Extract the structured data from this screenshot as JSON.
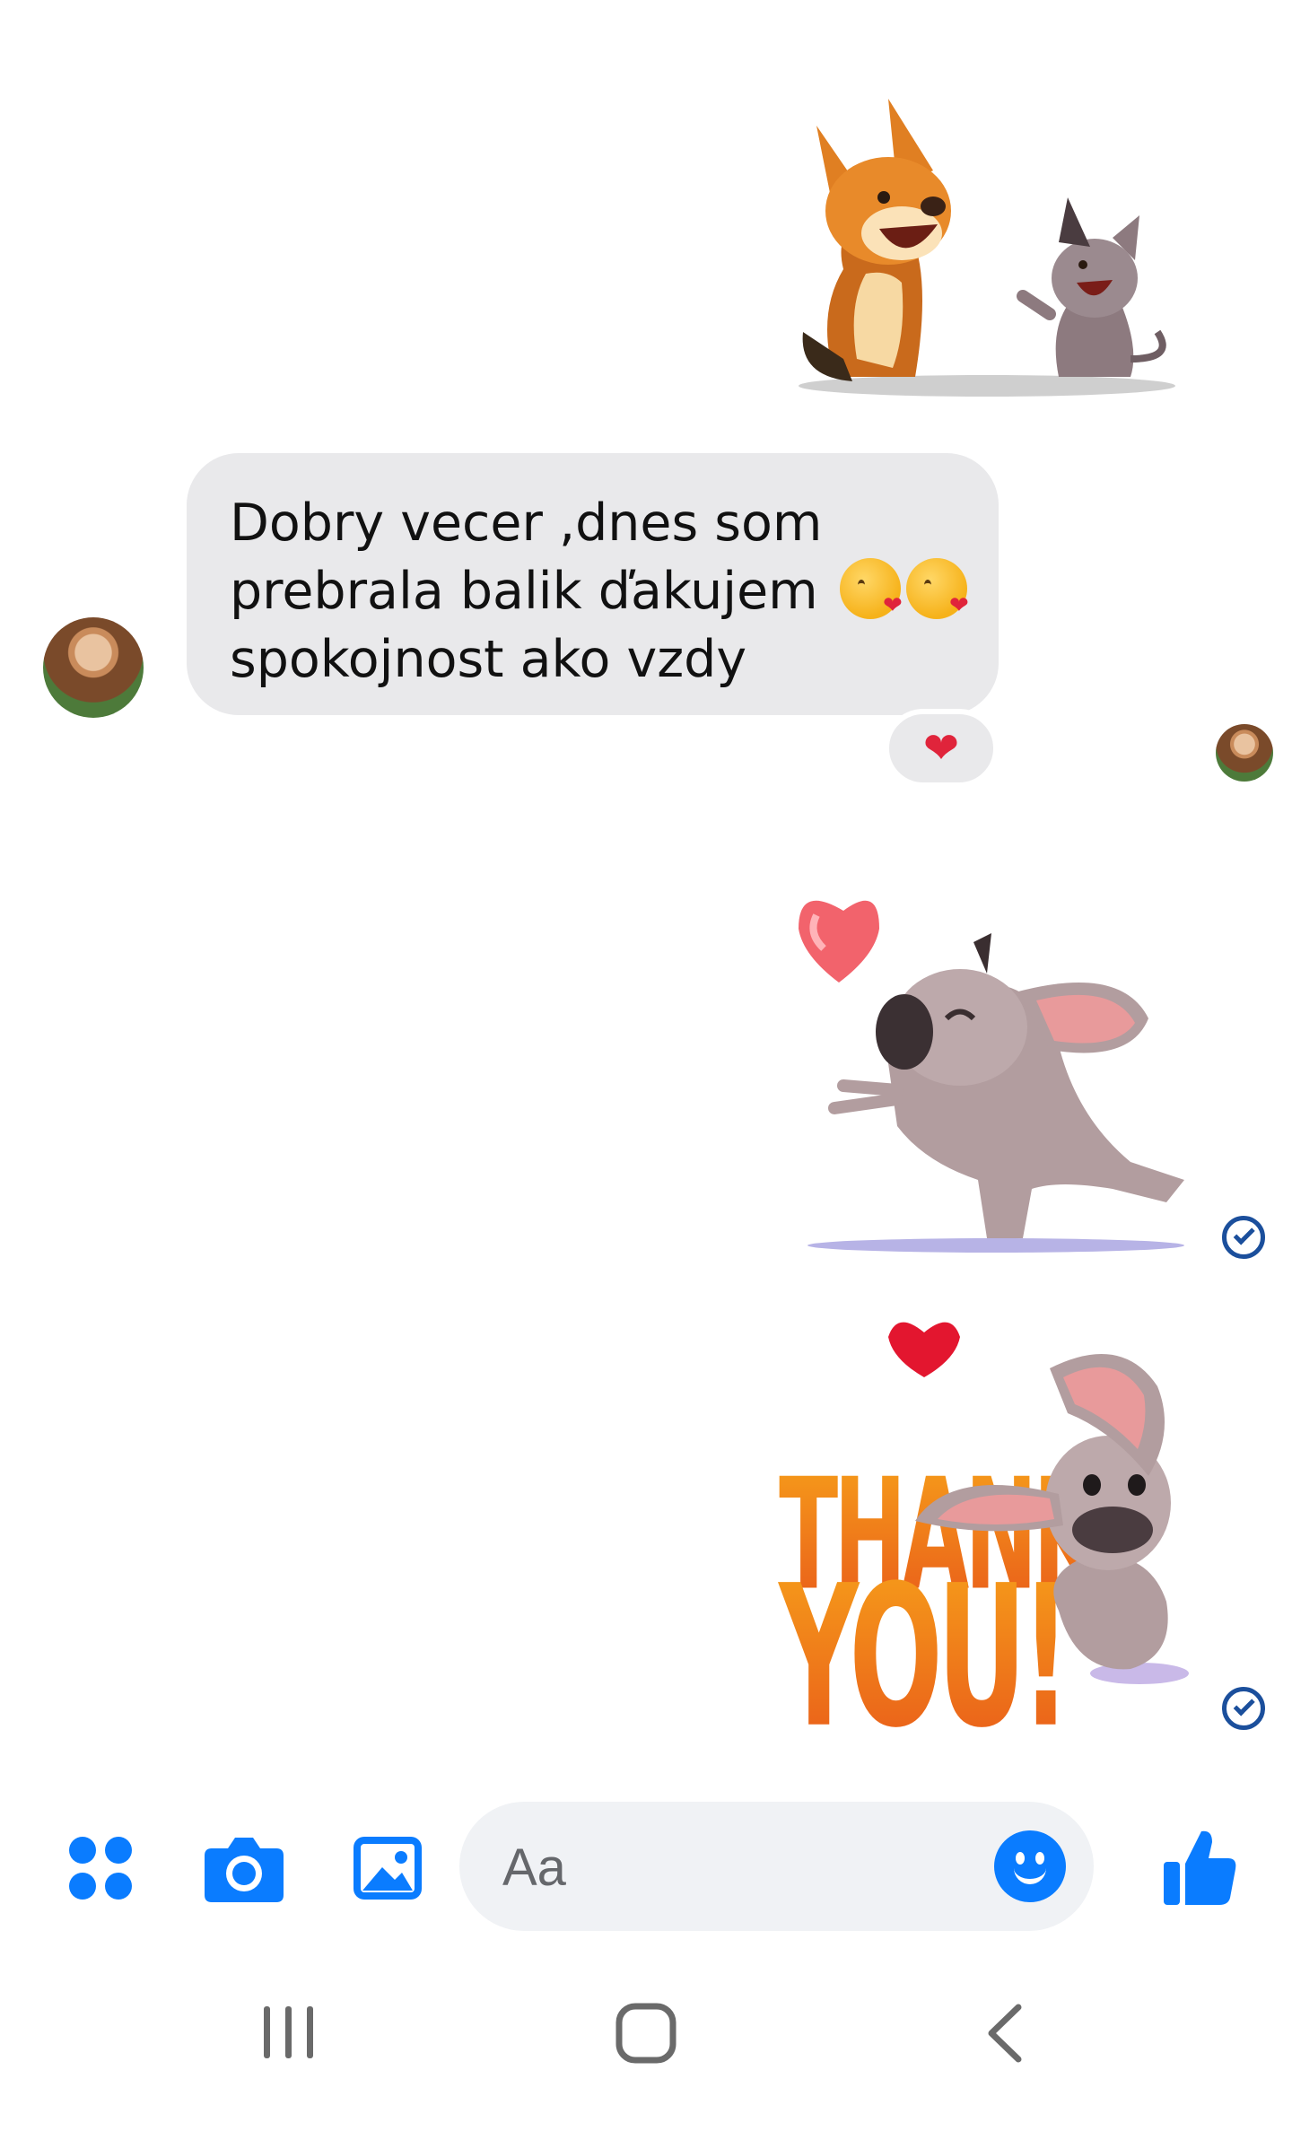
{
  "conversation": {
    "incoming_message": {
      "lines": [
        "Dobry vecer ,dnes som",
        "prebrala balik ďakujem",
        "spokojnost ako vzdy"
      ],
      "reaction": "heart"
    },
    "stickers": [
      {
        "name": "two-dogs-waving-sticker"
      },
      {
        "name": "dog-blowing-kiss-sticker"
      },
      {
        "name": "thank-you-sticker",
        "text_line1": "THANK",
        "text_line2": "YOU!"
      }
    ],
    "status": "seen"
  },
  "composer": {
    "placeholder": "Aa",
    "icons": [
      "apps-icon",
      "camera-icon",
      "gallery-icon",
      "emoji-icon",
      "thumbs-up-icon"
    ],
    "accent_color": "#0a7cff"
  },
  "navbar": {
    "icons": [
      "recents-icon",
      "home-icon",
      "back-icon"
    ]
  }
}
